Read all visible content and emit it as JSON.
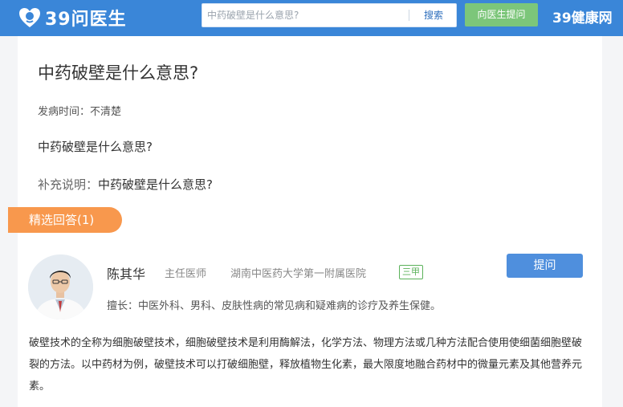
{
  "header": {
    "logo_text": "39问医生",
    "search_placeholder": "中药破壁是什么意思?",
    "search_button": "搜索",
    "ask_doctor_button": "向医生提问",
    "brand_right": "39健康网",
    "colors": {
      "bar": "#3a86d8",
      "ask_button": "#7cc67a"
    }
  },
  "question": {
    "title": "中药破壁是什么意思?",
    "onset": "发病时间：不清楚",
    "body": "中药破壁是什么意思?",
    "supplement_label": "补充说明：",
    "supplement_text": "中药破壁是什么意思?"
  },
  "answers": {
    "tab_label": "精选回答(1)",
    "tab_color": "#f8984d",
    "doctor": {
      "name": "陈其华",
      "title": "主任医师",
      "hospital": "湖南中医药大学第一附属医院",
      "grade": "三甲",
      "ask_button": "提问",
      "specialty": "擅长：中医外科、男科、皮肤性病的常见病和疑难病的诊疗及养生保健。"
    },
    "text": "破壁技术的全称为细胞破壁技术，细胞破壁技术是利用酶解法，化学方法、物理方法或几种方法配合使用使细菌细胞壁破裂的方法。以中药材为例，破壁技术可以打破细胞壁，释放植物生化素，最大限度地融合药材中的微量元素及其他营养元素。"
  }
}
